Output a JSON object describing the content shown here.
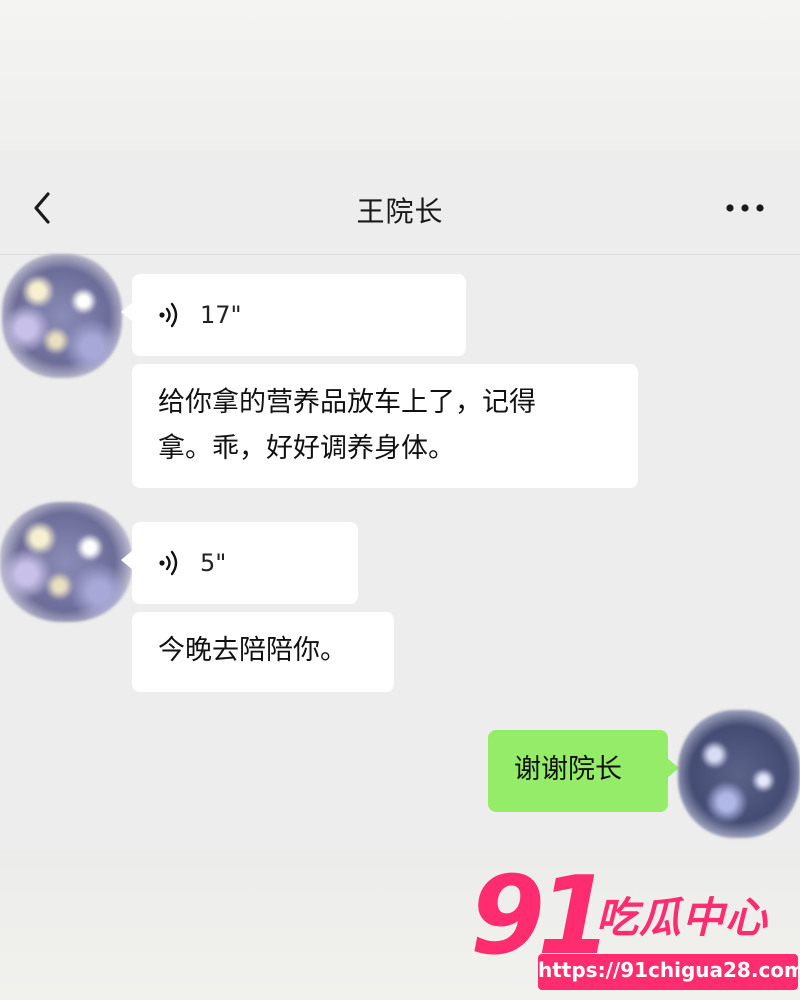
{
  "chat": {
    "title": "王院长"
  },
  "messages": [
    {
      "type": "voice",
      "duration": "17\""
    },
    {
      "type": "text",
      "line1": "给你拿的营养品放车上了，记得",
      "line2": "拿。乖，好好调养身体。"
    },
    {
      "type": "voice",
      "duration": "5\""
    },
    {
      "type": "text",
      "text": "今晚去陪陪你。"
    },
    {
      "type": "text",
      "text": "谢谢院长",
      "from_self": true
    }
  ],
  "watermark": {
    "number": "91",
    "brand": "吃瓜中心",
    "url": "https://91chigua28.com"
  },
  "icons": {
    "back": "chevron-left-icon",
    "more": "more-dots-icon",
    "voice": "voice-wave-icon"
  },
  "colors": {
    "self_bubble": "#95ec69",
    "watermark": "#ff2d6f"
  }
}
